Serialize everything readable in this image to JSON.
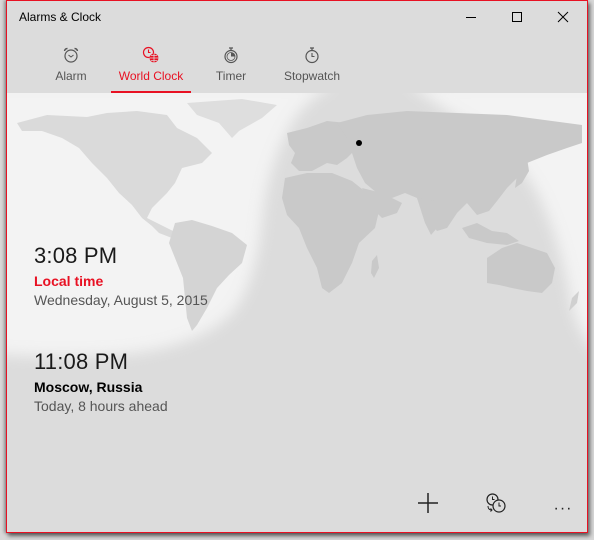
{
  "window": {
    "title": "Alarms & Clock",
    "controls": {
      "minimize": "minimize-icon",
      "maximize": "maximize-icon",
      "close": "close-icon"
    }
  },
  "tabs": [
    {
      "label": "Alarm",
      "icon": "alarm-clock-icon",
      "active": false
    },
    {
      "label": "World Clock",
      "icon": "world-clock-icon",
      "active": true
    },
    {
      "label": "Timer",
      "icon": "timer-icon",
      "active": false
    },
    {
      "label": "Stopwatch",
      "icon": "stopwatch-icon",
      "active": false
    }
  ],
  "clocks": [
    {
      "time": "3:08 PM",
      "place": "Local time",
      "detail": "Wednesday, August 5, 2015",
      "place_color": "#e81123"
    },
    {
      "time": "11:08 PM",
      "place": "Moscow, Russia",
      "detail": "Today, 8 hours ahead",
      "place_color": "#000000"
    }
  ],
  "map": {
    "pinned_city": "Moscow",
    "pin_icon": "location-dot-icon"
  },
  "commands": [
    {
      "name": "add",
      "icon": "plus-icon"
    },
    {
      "name": "compare",
      "icon": "compare-clocks-icon"
    },
    {
      "name": "more",
      "icon": "more-icon",
      "glyph": "···"
    }
  ],
  "colors": {
    "accent": "#e81123",
    "background": "#dcdcdc",
    "day_region": "#f2f2f2",
    "land": "#c4c4c4"
  }
}
